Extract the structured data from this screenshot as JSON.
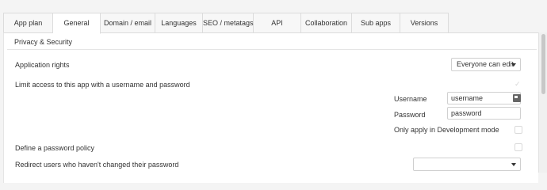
{
  "tabs": [
    {
      "label": "App plan"
    },
    {
      "label": "General"
    },
    {
      "label": "Domain / email"
    },
    {
      "label": "Languages"
    },
    {
      "label": "SEO / metatags"
    },
    {
      "label": "API"
    },
    {
      "label": "Collaboration"
    },
    {
      "label": "Sub apps"
    },
    {
      "label": "Versions"
    }
  ],
  "section": {
    "title": "Privacy & Security"
  },
  "rows": {
    "application_rights": {
      "label": "Application rights",
      "value": "Everyone can edit"
    },
    "limit_access": {
      "label": "Limit access to this app with a username and password",
      "check": "✓"
    },
    "username": {
      "label": "Username",
      "value": "username"
    },
    "password": {
      "label": "Password",
      "value": "password"
    },
    "dev_mode": {
      "label": "Only apply in Development mode"
    },
    "password_policy": {
      "label": "Define a password policy"
    },
    "redirect": {
      "label": "Redirect users who haven't changed their password",
      "value": ""
    }
  }
}
